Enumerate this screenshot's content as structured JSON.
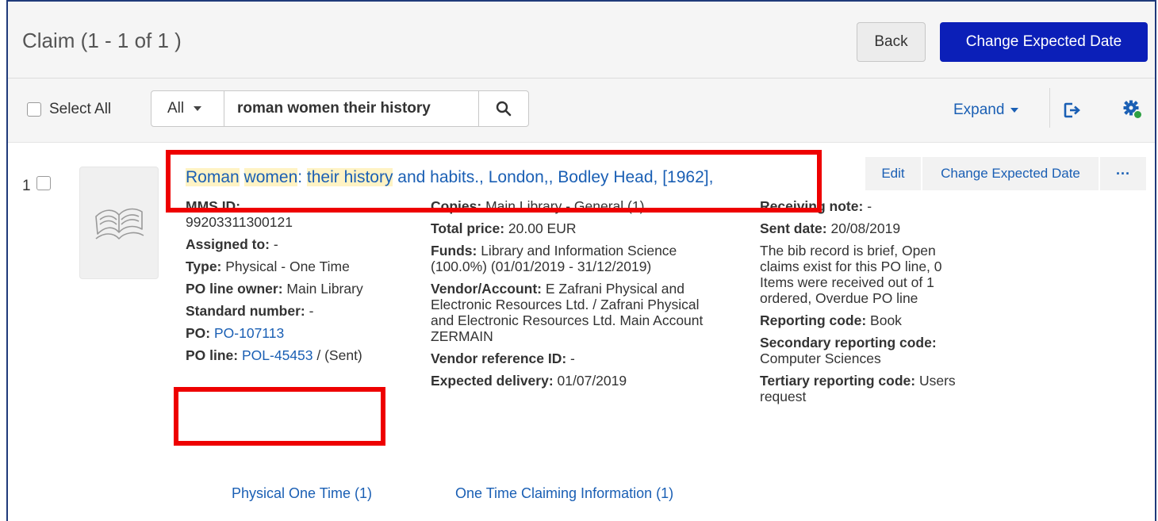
{
  "header": {
    "title": "Claim (1 - 1 of 1 )",
    "back_label": "Back",
    "change_expected_date_label": "Change Expected Date"
  },
  "toolbar": {
    "select_all_label": "Select All",
    "search_scope": "All",
    "search_value": "roman women their history",
    "expand_label": "Expand"
  },
  "result": {
    "index": "1",
    "title_parts": [
      "Roman",
      " ",
      "women",
      ": ",
      "their history",
      " and habits., London,, Bodley Head, [1962],"
    ],
    "actions": {
      "edit": "Edit",
      "change_expected_date": "Change Expected Date",
      "more": "···"
    },
    "col1": {
      "mms_label": "MMS ID:",
      "mms_value": "99203311300121",
      "assigned_label": "Assigned to:",
      "assigned_value": "-",
      "type_label": "Type:",
      "type_value": "Physical - One Time",
      "owner_label": "PO line owner:",
      "owner_value": "Main Library",
      "std_label": "Standard number:",
      "std_value": "-",
      "po_label": "PO:",
      "po_value": "PO-107113",
      "pol_label": "PO line:",
      "pol_value": "POL-45453",
      "pol_status": " / (Sent)"
    },
    "col2": {
      "copies_label": "Copies:",
      "copies_value": "Main Library - General (1)",
      "price_label": "Total price:",
      "price_value": "20.00 EUR",
      "funds_label": "Funds:",
      "funds_value": "Library and Information Science (100.0%) (01/01/2019 - 31/12/2019)",
      "vendor_label": "Vendor/Account:",
      "vendor_value": "E Zafrani Physical and Electronic Resources Ltd. / Zafrani Physical and Electronic Resources Ltd. Main Account ZERMAIN",
      "vref_label": "Vendor reference ID:",
      "vref_value": "-",
      "delivery_label": "Expected delivery:",
      "delivery_value": "01/07/2019"
    },
    "col3": {
      "rnote_label": "Receiving note:",
      "rnote_value": "-",
      "sent_label": "Sent date:",
      "sent_value": "20/08/2019",
      "alerts": "The bib record is brief, Open claims exist for this PO line, 0 Items were received out of 1 ordered, Overdue PO line",
      "rcode_label": "Reporting code:",
      "rcode_value": "Book",
      "rcode2_label": "Secondary reporting code:",
      "rcode2_value": "Computer Sciences",
      "rcode3_label": "Tertiary reporting code:",
      "rcode3_value": "Users request"
    },
    "bottom_links": [
      "Physical One Time (1)",
      "One Time Claiming Information (1)"
    ]
  },
  "icons": {
    "search": "search-icon",
    "export": "export-icon",
    "settings": "gear-icon",
    "thumbnail": "book-icon"
  },
  "colors": {
    "primary": "#0b1fb8",
    "link": "#1a5fb4",
    "annotation": "#ee0000",
    "highlight": "#fff3c4"
  }
}
